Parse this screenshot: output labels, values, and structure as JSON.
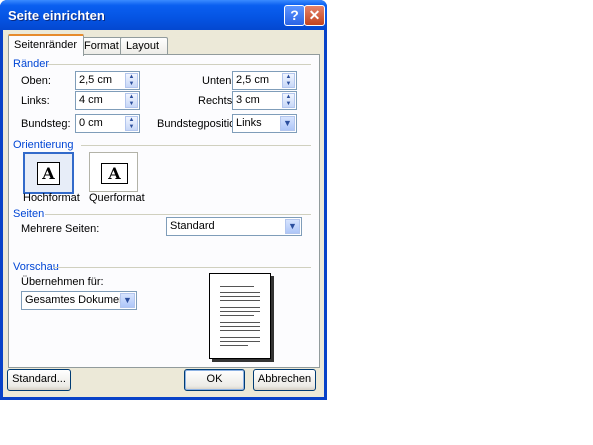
{
  "window": {
    "title": "Seite einrichten",
    "help_glyph": "?",
    "close_glyph": "✕"
  },
  "tabs": [
    {
      "label": "Seitenränder",
      "active": true
    },
    {
      "label": "Format",
      "active": false
    },
    {
      "label": "Layout",
      "active": false
    }
  ],
  "margins": {
    "group_label": "Ränder",
    "top": {
      "label": "Oben:",
      "value": "2,5 cm"
    },
    "left": {
      "label": "Links:",
      "value": "4 cm"
    },
    "gutter": {
      "label": "Bundsteg:",
      "value": "0 cm"
    },
    "bottom": {
      "label": "Unten:",
      "value": "2,5 cm"
    },
    "right": {
      "label": "Rechts:",
      "value": "3 cm"
    },
    "gutter_position": {
      "label": "Bundstegposition:",
      "value": "Links"
    }
  },
  "orientation": {
    "group_label": "Orientierung",
    "portrait_label": "Hochformat",
    "landscape_label": "Querformat",
    "icon_glyph": "A",
    "selected": "portrait"
  },
  "pages": {
    "group_label": "Seiten",
    "multiple_label": "Mehrere Seiten:",
    "multiple_value": "Standard"
  },
  "preview": {
    "group_label": "Vorschau",
    "apply_label": "Übernehmen für:",
    "apply_value": "Gesamtes Dokument"
  },
  "buttons": {
    "default": "Standard...",
    "ok": "OK",
    "cancel": "Abbrechen"
  },
  "colors": {
    "titlebar": "#0554e3",
    "accent_tab": "#e68b2c",
    "group_label": "#0046d5",
    "dialog_bg": "#ece9d8"
  }
}
